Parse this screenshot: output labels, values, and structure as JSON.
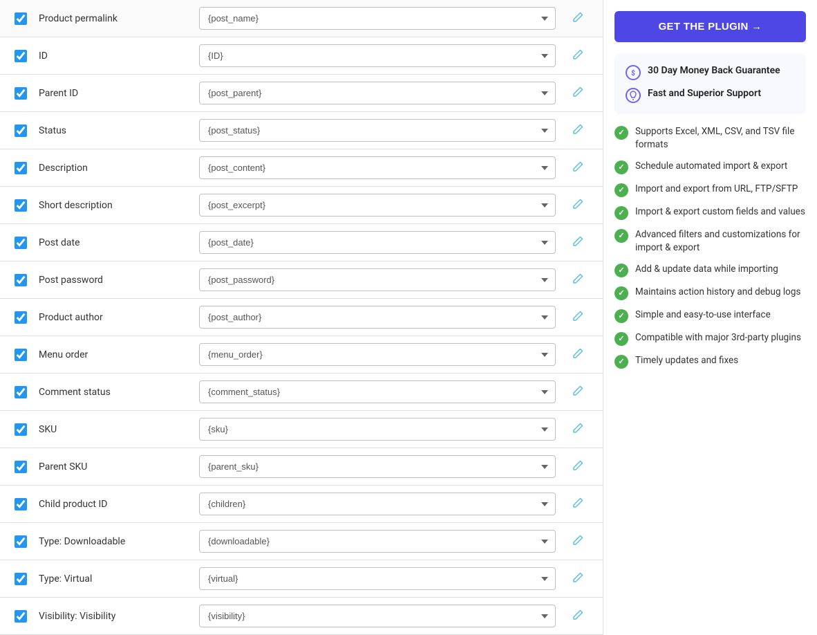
{
  "colors": {
    "accent_blue": "#4e46e5",
    "check_green": "#4caf50",
    "edit_cyan": "#5bc0de"
  },
  "fields": [
    {
      "id": "product-permalink",
      "label": "Product permalink",
      "value": "{post_name}",
      "checked": true
    },
    {
      "id": "id",
      "label": "ID",
      "value": "{ID}",
      "checked": true
    },
    {
      "id": "parent-id",
      "label": "Parent ID",
      "value": "{post_parent}",
      "checked": true
    },
    {
      "id": "status",
      "label": "Status",
      "value": "{post_status}",
      "checked": true
    },
    {
      "id": "description",
      "label": "Description",
      "value": "{post_content}",
      "checked": true
    },
    {
      "id": "short-description",
      "label": "Short description",
      "value": "{post_excerpt}",
      "checked": true
    },
    {
      "id": "post-date",
      "label": "Post date",
      "value": "{post_date}",
      "checked": true
    },
    {
      "id": "post-password",
      "label": "Post password",
      "value": "{post_password}",
      "checked": true
    },
    {
      "id": "product-author",
      "label": "Product author",
      "value": "{post_author}",
      "checked": true
    },
    {
      "id": "menu-order",
      "label": "Menu order",
      "value": "{menu_order}",
      "checked": true
    },
    {
      "id": "comment-status",
      "label": "Comment status",
      "value": "{comment_status}",
      "checked": true
    },
    {
      "id": "sku",
      "label": "SKU",
      "value": "{sku}",
      "checked": true
    },
    {
      "id": "parent-sku",
      "label": "Parent SKU",
      "value": "{parent_sku}",
      "checked": true
    },
    {
      "id": "child-product-id",
      "label": "Child product ID",
      "value": "{children}",
      "checked": true
    },
    {
      "id": "type-downloadable",
      "label": "Type: Downloadable",
      "value": "{downloadable}",
      "checked": true
    },
    {
      "id": "type-virtual",
      "label": "Type: Virtual",
      "value": "{virtual}",
      "checked": true
    },
    {
      "id": "visibility-visibility",
      "label": "Visibility: Visibility",
      "value": "{visibility}",
      "checked": true
    }
  ],
  "sidebar": {
    "cta_button": "GET THE PLUGIN →",
    "guarantee": {
      "money_back": "30 Day Money Back Guarantee",
      "support": "Fast and Superior Support"
    },
    "features": [
      "Supports Excel, XML, CSV, and TSV file formats",
      "Schedule automated import & export",
      "Import and export from URL, FTP/SFTP",
      "Import & export custom fields and values",
      "Advanced filters and customizations for import & export",
      "Add & update data while importing",
      "Maintains action history and debug logs",
      "Simple and easy-to-use interface",
      "Compatible with major 3rd-party plugins",
      "Timely updates and fixes"
    ]
  }
}
